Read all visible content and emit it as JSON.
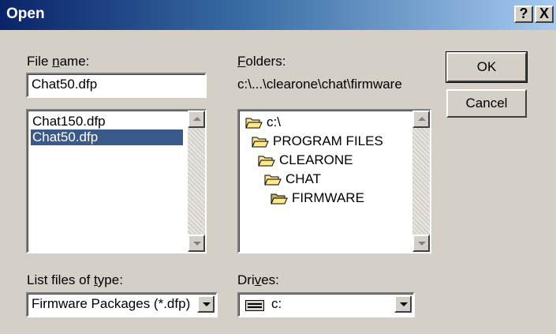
{
  "window": {
    "title": "Open",
    "help_glyph": "?",
    "close_glyph": "X"
  },
  "file_name": {
    "label_pre": "File ",
    "label_key": "n",
    "label_post": "ame:",
    "value": "Chat50.dfp"
  },
  "files": [
    {
      "name": "Chat150.dfp",
      "selected": false
    },
    {
      "name": "Chat50.dfp",
      "selected": true
    }
  ],
  "folders": {
    "label_key": "F",
    "label_post": "olders:",
    "current_path": "c:\\...\\clearone\\chat\\firmware",
    "tree": [
      {
        "name": "c:\\",
        "level": 0,
        "open": true
      },
      {
        "name": "PROGRAM FILES",
        "level": 1,
        "open": true
      },
      {
        "name": "CLEARONE",
        "level": 2,
        "open": true
      },
      {
        "name": "CHAT",
        "level": 3,
        "open": true
      },
      {
        "name": "FIRMWARE",
        "level": 4,
        "open": true,
        "current": true
      }
    ]
  },
  "file_type": {
    "label_pre": "List files of ",
    "label_key": "t",
    "label_post": "ype:",
    "value": "Firmware Packages  (*.dfp)"
  },
  "drives": {
    "label_pre": "Dri",
    "label_key": "v",
    "label_post": "es:",
    "value": "c:",
    "icon": "drive-icon"
  },
  "buttons": {
    "ok": "OK",
    "cancel": "Cancel"
  },
  "colors": {
    "face": "#d4d0c8",
    "title_start": "#0a246a",
    "title_end": "#a6caf0",
    "selection": "#3a5a8c",
    "folder": "#ffe98a"
  }
}
